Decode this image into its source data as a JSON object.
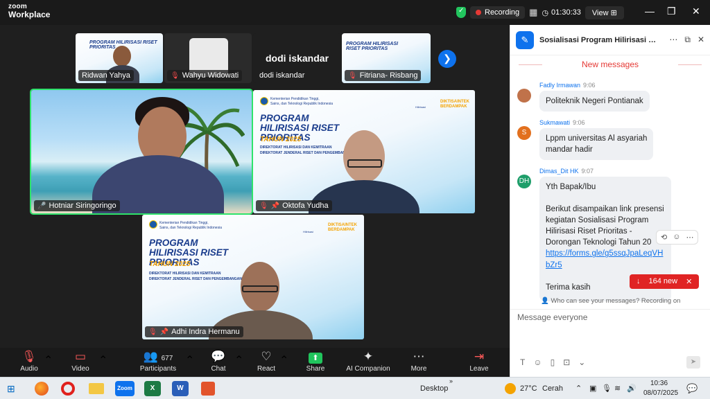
{
  "titlebar": {
    "logo_line1": "zoom",
    "logo_line2": "Workplace",
    "recording_label": "Recording",
    "timer": "01:30:33",
    "view_label": "View"
  },
  "gallery": {
    "thumbs": [
      {
        "name": "Ridwan Yahya",
        "muted": false
      },
      {
        "name": "Wahyu Widowati",
        "muted": true
      },
      {
        "name": "dodi iskandar",
        "muted": false
      },
      {
        "name": "Fitriana- Risbang",
        "muted": true
      }
    ],
    "big_name": "dodi iskandar",
    "tiles": [
      {
        "name": "Hotniar Siringoringo"
      },
      {
        "name": "Oktofa Yudha"
      },
      {
        "name": "Adhi Indra Hermanu"
      }
    ],
    "slide": {
      "title": "PROGRAM HILIRISASI RISET PRIORITAS",
      "year": "TAHUN 2025",
      "sub1": "DIREKTORAT HILIRISASI DAN KEMITRAAN",
      "sub2": "DIREKTORAT JENDERAL RISET DAN PENGEMBANGAN",
      "org1": "Kementerian Pendidikan Tinggi,",
      "org2": "Sains, dan Teknologi Republik Indonesia",
      "brand1": "DIKTISAINTEK",
      "brand2": "BERDAMPAK",
      "hilirisasi": "Hilirisasi"
    }
  },
  "toolbar": {
    "audio": "Audio",
    "video": "Video",
    "participants": "Participants",
    "participants_count": "677",
    "chat": "Chat",
    "react": "React",
    "share": "Share",
    "ai": "AI Companion",
    "more": "More",
    "leave": "Leave"
  },
  "chat": {
    "title": "Sosialisasi Program Hilirisasi Riset Prioritas",
    "new_messages": "New messages",
    "messages": [
      {
        "sender": "Fadly Irmawan",
        "time": "9:06",
        "text": "Politeknik Negeri Pontianak",
        "avatar": "",
        "color": "#c0724a"
      },
      {
        "sender": "Sukmawati",
        "time": "9:06",
        "text1": "Lppm universitas Al asyariah",
        "text2": "mandar hadir",
        "avatar": "S",
        "color": "#e2701e"
      },
      {
        "sender": "Dimas_Dit HK",
        "time": "9:07",
        "avatar": "DH",
        "color": "#1e9e6a",
        "line1": "Yth Bapak/Ibu",
        "line2": "Berikut disampaikan link presensi",
        "line3": "kegiatan Sosialisasi Program",
        "line4": "Hilirisasi Riset Prioritas -",
        "line5": "Dorongan Teknologi Tahun 20",
        "link1": "https://forms.gle/g5ssqJpaLeqVH",
        "link2": "bZr5",
        "line6": "Terima kasih"
      }
    ],
    "new_badge": "164 new",
    "who_can_see": "Who can see your messages? Recording on",
    "input_placeholder": "Message everyone"
  },
  "taskbar": {
    "desktop": "Desktop",
    "weather_temp": "27°C",
    "weather_desc": "Cerah",
    "time": "10:36",
    "date": "08/07/2025",
    "apps": [
      {
        "label": "Zoom",
        "color": "#0e72ed"
      },
      {
        "label": "X",
        "color": "#1d7a44"
      },
      {
        "label": "W",
        "color": "#2a5eb8"
      }
    ]
  }
}
